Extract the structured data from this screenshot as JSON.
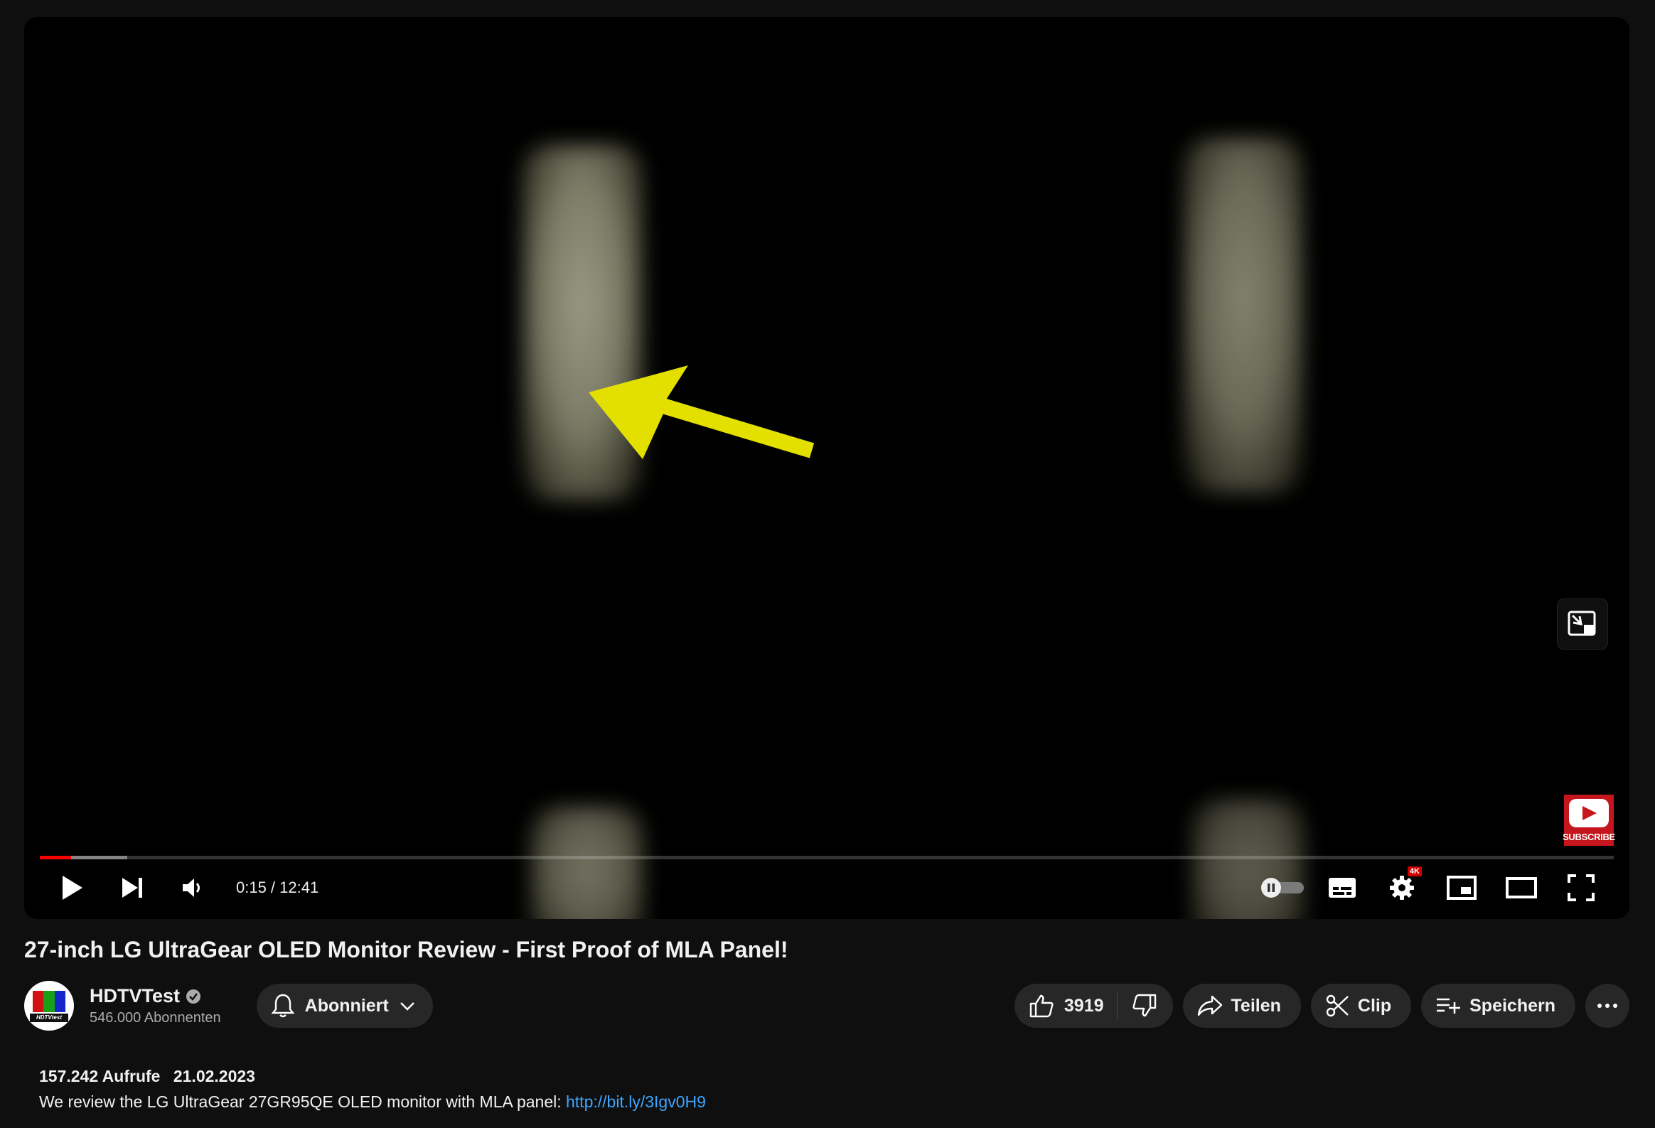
{
  "player": {
    "current_time": "0:15",
    "duration": "12:41",
    "time_display": "0:15 / 12:41",
    "progress_fraction": 0.0197,
    "buffered_fraction": 0.0556,
    "quality_badge": "4K",
    "subscribe_watermark": "SUBSCRIBE",
    "accent_color": "#ff0000",
    "overlay_arrow_color": "#e3e000"
  },
  "video": {
    "title": "27-inch LG UltraGear OLED Monitor Review - First Proof of MLA Panel!"
  },
  "channel": {
    "name": "HDTVTest",
    "verified": true,
    "subscribers": "546.000 Abonnenten",
    "avatar_label": "HDTVtest"
  },
  "actions": {
    "subscribed_label": "Abonniert",
    "like_count": "3919",
    "share_label": "Teilen",
    "clip_label": "Clip",
    "save_label": "Speichern"
  },
  "description": {
    "views": "157.242 Aufrufe",
    "date": "21.02.2023",
    "text": "We review the LG UltraGear 27GR95QE OLED monitor with MLA panel: ",
    "link": "http://bit.ly/3Igv0H9"
  }
}
